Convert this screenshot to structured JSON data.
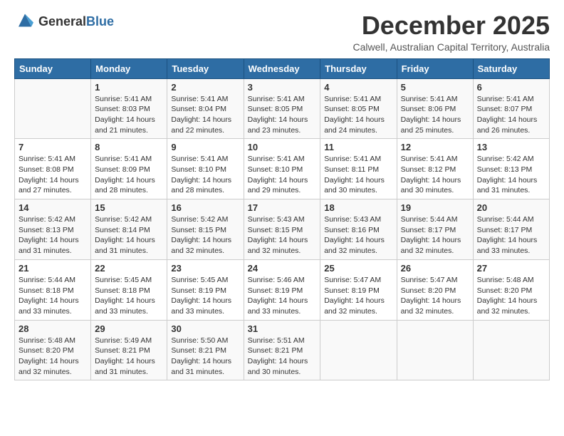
{
  "header": {
    "logo_general": "General",
    "logo_blue": "Blue",
    "month": "December 2025",
    "location": "Calwell, Australian Capital Territory, Australia"
  },
  "days_of_week": [
    "Sunday",
    "Monday",
    "Tuesday",
    "Wednesday",
    "Thursday",
    "Friday",
    "Saturday"
  ],
  "weeks": [
    [
      {
        "day": "",
        "info": ""
      },
      {
        "day": "1",
        "info": "Sunrise: 5:41 AM\nSunset: 8:03 PM\nDaylight: 14 hours\nand 21 minutes."
      },
      {
        "day": "2",
        "info": "Sunrise: 5:41 AM\nSunset: 8:04 PM\nDaylight: 14 hours\nand 22 minutes."
      },
      {
        "day": "3",
        "info": "Sunrise: 5:41 AM\nSunset: 8:05 PM\nDaylight: 14 hours\nand 23 minutes."
      },
      {
        "day": "4",
        "info": "Sunrise: 5:41 AM\nSunset: 8:05 PM\nDaylight: 14 hours\nand 24 minutes."
      },
      {
        "day": "5",
        "info": "Sunrise: 5:41 AM\nSunset: 8:06 PM\nDaylight: 14 hours\nand 25 minutes."
      },
      {
        "day": "6",
        "info": "Sunrise: 5:41 AM\nSunset: 8:07 PM\nDaylight: 14 hours\nand 26 minutes."
      }
    ],
    [
      {
        "day": "7",
        "info": "Sunrise: 5:41 AM\nSunset: 8:08 PM\nDaylight: 14 hours\nand 27 minutes."
      },
      {
        "day": "8",
        "info": "Sunrise: 5:41 AM\nSunset: 8:09 PM\nDaylight: 14 hours\nand 28 minutes."
      },
      {
        "day": "9",
        "info": "Sunrise: 5:41 AM\nSunset: 8:10 PM\nDaylight: 14 hours\nand 28 minutes."
      },
      {
        "day": "10",
        "info": "Sunrise: 5:41 AM\nSunset: 8:10 PM\nDaylight: 14 hours\nand 29 minutes."
      },
      {
        "day": "11",
        "info": "Sunrise: 5:41 AM\nSunset: 8:11 PM\nDaylight: 14 hours\nand 30 minutes."
      },
      {
        "day": "12",
        "info": "Sunrise: 5:41 AM\nSunset: 8:12 PM\nDaylight: 14 hours\nand 30 minutes."
      },
      {
        "day": "13",
        "info": "Sunrise: 5:42 AM\nSunset: 8:13 PM\nDaylight: 14 hours\nand 31 minutes."
      }
    ],
    [
      {
        "day": "14",
        "info": "Sunrise: 5:42 AM\nSunset: 8:13 PM\nDaylight: 14 hours\nand 31 minutes."
      },
      {
        "day": "15",
        "info": "Sunrise: 5:42 AM\nSunset: 8:14 PM\nDaylight: 14 hours\nand 31 minutes."
      },
      {
        "day": "16",
        "info": "Sunrise: 5:42 AM\nSunset: 8:15 PM\nDaylight: 14 hours\nand 32 minutes."
      },
      {
        "day": "17",
        "info": "Sunrise: 5:43 AM\nSunset: 8:15 PM\nDaylight: 14 hours\nand 32 minutes."
      },
      {
        "day": "18",
        "info": "Sunrise: 5:43 AM\nSunset: 8:16 PM\nDaylight: 14 hours\nand 32 minutes."
      },
      {
        "day": "19",
        "info": "Sunrise: 5:44 AM\nSunset: 8:17 PM\nDaylight: 14 hours\nand 32 minutes."
      },
      {
        "day": "20",
        "info": "Sunrise: 5:44 AM\nSunset: 8:17 PM\nDaylight: 14 hours\nand 33 minutes."
      }
    ],
    [
      {
        "day": "21",
        "info": "Sunrise: 5:44 AM\nSunset: 8:18 PM\nDaylight: 14 hours\nand 33 minutes."
      },
      {
        "day": "22",
        "info": "Sunrise: 5:45 AM\nSunset: 8:18 PM\nDaylight: 14 hours\nand 33 minutes."
      },
      {
        "day": "23",
        "info": "Sunrise: 5:45 AM\nSunset: 8:19 PM\nDaylight: 14 hours\nand 33 minutes."
      },
      {
        "day": "24",
        "info": "Sunrise: 5:46 AM\nSunset: 8:19 PM\nDaylight: 14 hours\nand 33 minutes."
      },
      {
        "day": "25",
        "info": "Sunrise: 5:47 AM\nSunset: 8:19 PM\nDaylight: 14 hours\nand 32 minutes."
      },
      {
        "day": "26",
        "info": "Sunrise: 5:47 AM\nSunset: 8:20 PM\nDaylight: 14 hours\nand 32 minutes."
      },
      {
        "day": "27",
        "info": "Sunrise: 5:48 AM\nSunset: 8:20 PM\nDaylight: 14 hours\nand 32 minutes."
      }
    ],
    [
      {
        "day": "28",
        "info": "Sunrise: 5:48 AM\nSunset: 8:20 PM\nDaylight: 14 hours\nand 32 minutes."
      },
      {
        "day": "29",
        "info": "Sunrise: 5:49 AM\nSunset: 8:21 PM\nDaylight: 14 hours\nand 31 minutes."
      },
      {
        "day": "30",
        "info": "Sunrise: 5:50 AM\nSunset: 8:21 PM\nDaylight: 14 hours\nand 31 minutes."
      },
      {
        "day": "31",
        "info": "Sunrise: 5:51 AM\nSunset: 8:21 PM\nDaylight: 14 hours\nand 30 minutes."
      },
      {
        "day": "",
        "info": ""
      },
      {
        "day": "",
        "info": ""
      },
      {
        "day": "",
        "info": ""
      }
    ]
  ]
}
